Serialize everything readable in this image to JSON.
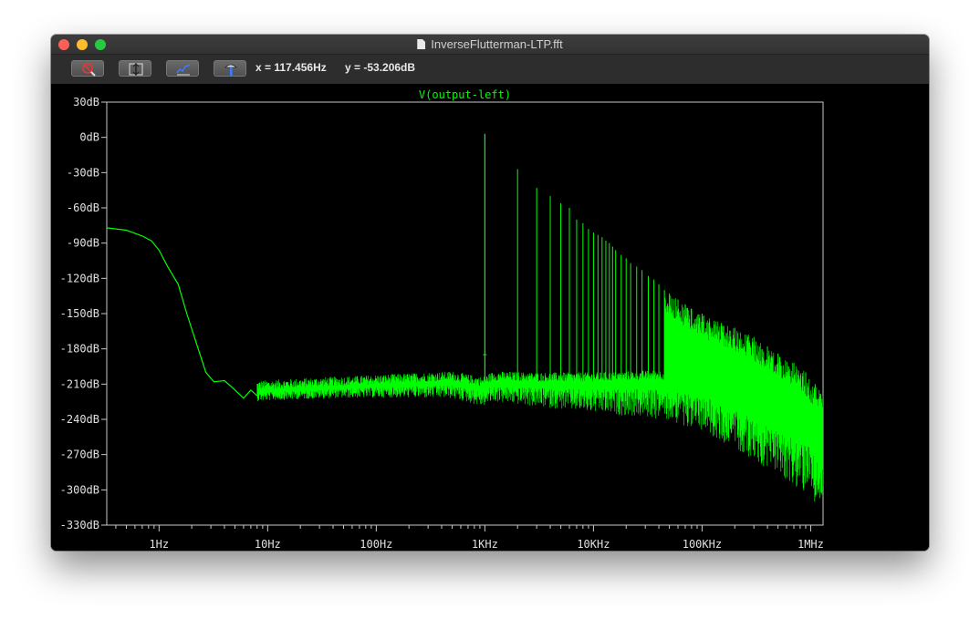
{
  "window": {
    "title": "InverseFlutterman-LTP.fft"
  },
  "toolbar": {
    "buttons": [
      {
        "name": "zoom-cancel-button",
        "icon": "zoom-cancel-icon"
      },
      {
        "name": "autorange-y-button",
        "icon": "autorange-y-icon"
      },
      {
        "name": "autorange-button",
        "icon": "autorange-icon"
      },
      {
        "name": "probe-button",
        "icon": "probe-icon"
      }
    ],
    "cursor_x": "x = 117.456Hz",
    "cursor_y": "y = -53.206dB"
  },
  "colors": {
    "trace": "#00ff00",
    "background": "#000000",
    "axis": "#c8c8c8",
    "tick_text": "#e0e0e0"
  },
  "chart_data": {
    "type": "line",
    "title": "V(output-left)",
    "xscale": "log",
    "xlim": [
      0.33,
      1300000
    ],
    "ylim": [
      -330,
      30
    ],
    "xticks": [
      {
        "value": 1,
        "label": "1Hz"
      },
      {
        "value": 10,
        "label": "10Hz"
      },
      {
        "value": 100,
        "label": "100Hz"
      },
      {
        "value": 1000,
        "label": "1KHz"
      },
      {
        "value": 10000,
        "label": "10KHz"
      },
      {
        "value": 100000,
        "label": "100KHz"
      },
      {
        "value": 1000000,
        "label": "1MHz"
      }
    ],
    "yticks": [
      {
        "value": 30,
        "label": "30dB"
      },
      {
        "value": 0,
        "label": "0dB"
      },
      {
        "value": -30,
        "label": "-30dB"
      },
      {
        "value": -60,
        "label": "-60dB"
      },
      {
        "value": -90,
        "label": "-90dB"
      },
      {
        "value": -120,
        "label": "-120dB"
      },
      {
        "value": -150,
        "label": "-150dB"
      },
      {
        "value": -180,
        "label": "-180dB"
      },
      {
        "value": -210,
        "label": "-210dB"
      },
      {
        "value": -240,
        "label": "-240dB"
      },
      {
        "value": -270,
        "label": "-270dB"
      },
      {
        "value": -300,
        "label": "-300dB"
      },
      {
        "value": -330,
        "label": "-330dB"
      }
    ],
    "lowfreq_curve": {
      "x": [
        0.33,
        0.5,
        0.7,
        0.85,
        1.0,
        1.2,
        1.5,
        1.8,
        2.2,
        2.7,
        3.2,
        4.0,
        5.0,
        6.0,
        7.0,
        8.0
      ],
      "y": [
        -77,
        -79,
        -84,
        -88,
        -96,
        -110,
        -125,
        -150,
        -175,
        -200,
        -208,
        -207,
        -215,
        -222,
        -215,
        -220
      ]
    },
    "noise_floor": {
      "x": [
        8,
        20,
        100,
        500,
        950,
        1200,
        3000,
        10000,
        40000,
        100000,
        300000,
        1000000,
        1300000
      ],
      "y": [
        -215,
        -213,
        -210,
        -207,
        -212,
        -207,
        -208,
        -208,
        -206,
        -210,
        -228,
        -250,
        -265
      ]
    },
    "peak": {
      "x": 1000,
      "y": 3
    },
    "harmonics": [
      {
        "x": 2000,
        "y": -27
      },
      {
        "x": 3000,
        "y": -43
      },
      {
        "x": 4000,
        "y": -50
      },
      {
        "x": 5000,
        "y": -56
      },
      {
        "x": 6000,
        "y": -60
      },
      {
        "x": 7000,
        "y": -70
      },
      {
        "x": 8000,
        "y": -73
      },
      {
        "x": 9000,
        "y": -78
      },
      {
        "x": 10000,
        "y": -81
      },
      {
        "x": 11000,
        "y": -83
      },
      {
        "x": 12000,
        "y": -85
      },
      {
        "x": 13000,
        "y": -88
      },
      {
        "x": 14000,
        "y": -90
      },
      {
        "x": 15000,
        "y": -93
      },
      {
        "x": 16000,
        "y": -96
      },
      {
        "x": 18000,
        "y": -100
      },
      {
        "x": 20000,
        "y": -103
      },
      {
        "x": 22000,
        "y": -107
      },
      {
        "x": 25000,
        "y": -110
      },
      {
        "x": 28000,
        "y": -113
      },
      {
        "x": 32000,
        "y": -118
      },
      {
        "x": 36000,
        "y": -121
      },
      {
        "x": 40000,
        "y": -125
      },
      {
        "x": 45000,
        "y": -130
      },
      {
        "x": 50000,
        "y": -133
      },
      {
        "x": 60000,
        "y": -138
      },
      {
        "x": 70000,
        "y": -142
      },
      {
        "x": 80000,
        "y": -146
      },
      {
        "x": 100000,
        "y": -150
      },
      {
        "x": 150000,
        "y": -158
      },
      {
        "x": 200000,
        "y": -162
      },
      {
        "x": 300000,
        "y": -170
      },
      {
        "x": 400000,
        "y": -178
      },
      {
        "x": 500000,
        "y": -184
      },
      {
        "x": 700000,
        "y": -192
      },
      {
        "x": 900000,
        "y": -200
      },
      {
        "x": 1100000,
        "y": -210
      }
    ],
    "dense_band_start": 45000
  }
}
